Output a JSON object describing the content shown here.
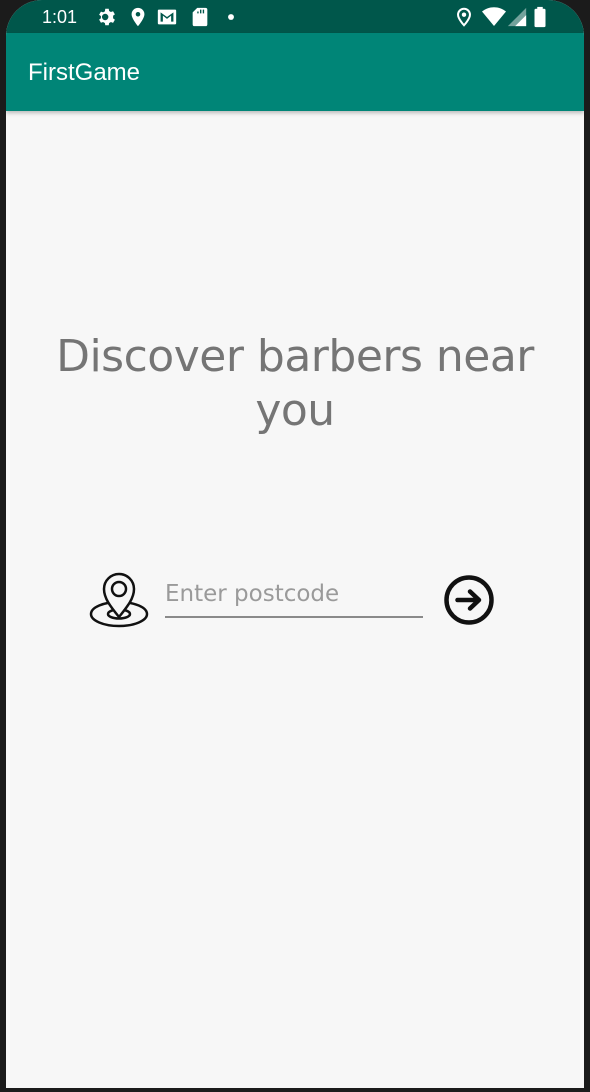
{
  "status_bar": {
    "time": "1:01",
    "icons_left": [
      "settings-icon",
      "location-pin-icon",
      "gmail-icon",
      "sd-card-icon",
      "notification-dot-icon"
    ],
    "icons_right": [
      "location-icon",
      "wifi-icon",
      "signal-icon",
      "battery-icon"
    ]
  },
  "app_bar": {
    "title": "FirstGame",
    "color": "#008577",
    "status_color": "#00574b"
  },
  "main": {
    "headline": "Discover barbers near you",
    "postcode_placeholder": "Enter postcode",
    "postcode_value": "",
    "location_icon": "location-marker-icon",
    "submit_icon": "arrow-right-circle-icon"
  },
  "colors": {
    "background": "#f7f7f7",
    "headline_text": "#757575"
  }
}
